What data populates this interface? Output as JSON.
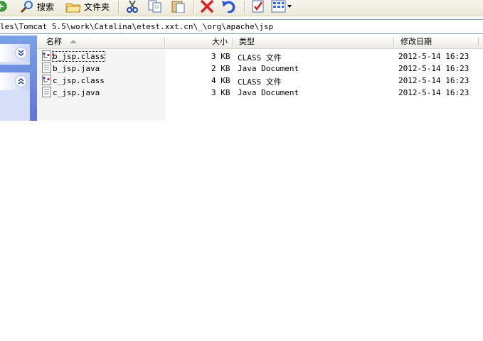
{
  "toolbar": {
    "search_label": "搜索",
    "folders_label": "文件夹"
  },
  "address": {
    "path": "les\\Tomcat 5.5\\work\\Catalina\\etest.xxt.cn\\_\\org\\apache\\jsp"
  },
  "columns": {
    "name": "名称",
    "size": "大小",
    "type": "类型",
    "modified": "修改日期"
  },
  "files": [
    {
      "name": "b_jsp.class",
      "size": "3 KB",
      "type": "CLASS 文件",
      "modified": "2012-5-14 16:23",
      "icon": "class-file-icon"
    },
    {
      "name": "b_jsp.java",
      "size": "2 KB",
      "type": "Java Document",
      "modified": "2012-5-14 16:23",
      "icon": "java-file-icon"
    },
    {
      "name": "c_jsp.class",
      "size": "4 KB",
      "type": "CLASS 文件",
      "modified": "2012-5-14 16:23",
      "icon": "class-file-icon"
    },
    {
      "name": "c_jsp.java",
      "size": "3 KB",
      "type": "Java Document",
      "modified": "2012-5-14 16:23",
      "icon": "java-file-icon"
    }
  ],
  "colors": {
    "taskpane": "#6375d6",
    "delete_red": "#e02020",
    "undo_blue": "#2a5bd7"
  }
}
